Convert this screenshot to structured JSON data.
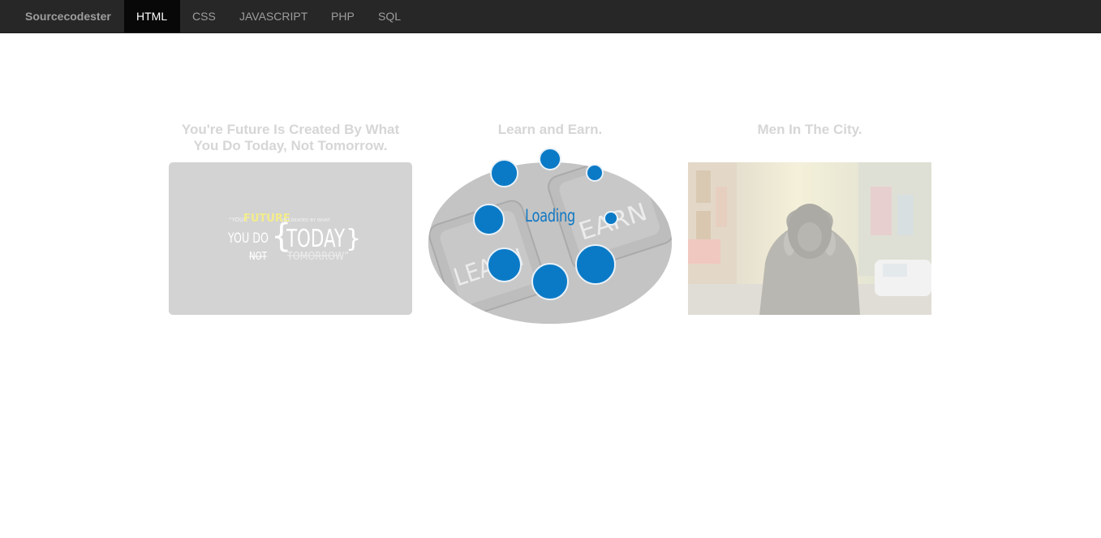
{
  "navbar": {
    "brand": "Sourcecodester",
    "items": [
      {
        "label": "HTML",
        "active": true
      },
      {
        "label": "CSS",
        "active": false
      },
      {
        "label": "JAVASCRIPT",
        "active": false
      },
      {
        "label": "PHP",
        "active": false
      },
      {
        "label": "SQL",
        "active": false
      }
    ]
  },
  "cards": [
    {
      "title": "You're Future Is Created By What You Do Today, Not Tomorrow.",
      "image_text": {
        "line1_small": "“YOUR",
        "line1_highlight": "FUTURE",
        "line1_rest": "IS CREATED BY WHAT",
        "you_do": "YOU DO",
        "not": "NOT",
        "today": "TODAY",
        "tomorrow": "TOMORROW”"
      }
    },
    {
      "title": "Learn and Earn.",
      "key_left": "LEARN",
      "key_right": "EARN"
    },
    {
      "title": "Men In The City."
    }
  ],
  "loading": {
    "label": "Loading"
  },
  "colors": {
    "navbar_bg": "#272727",
    "nav_active_bg": "#080808",
    "accent_blue": "#0a7ac6",
    "title_gray": "#d6d6d6",
    "highlight_yellow": "#f3ec8a"
  }
}
